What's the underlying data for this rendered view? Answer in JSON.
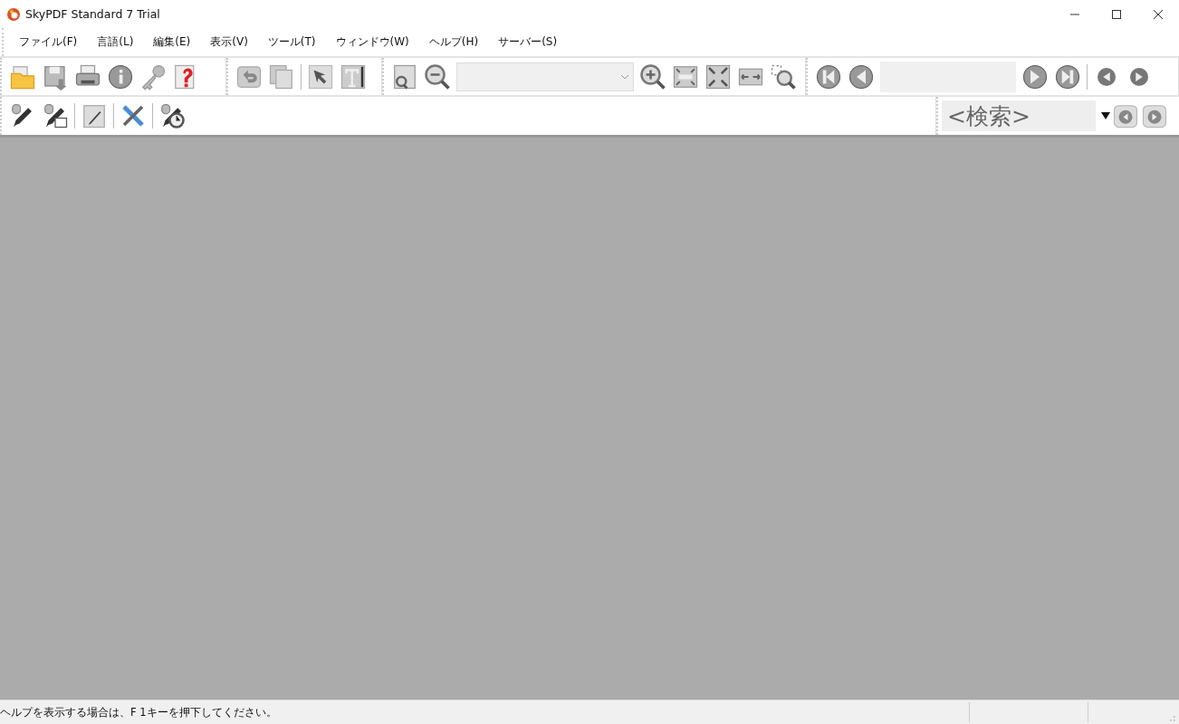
{
  "window": {
    "title": "SkyPDF Standard 7 Trial"
  },
  "menu": [
    {
      "label": "ファイル(F)"
    },
    {
      "label": "言語(L)"
    },
    {
      "label": "編集(E)"
    },
    {
      "label": "表示(V)"
    },
    {
      "label": "ツール(T)"
    },
    {
      "label": "ウィンドウ(W)"
    },
    {
      "label": "ヘルプ(H)"
    },
    {
      "label": "サーバー(S)"
    }
  ],
  "search": {
    "placeholder": "<検索>"
  },
  "status_bar": {
    "message": "ヘルプを表示する場合は、F 1キーを押下してください。"
  }
}
